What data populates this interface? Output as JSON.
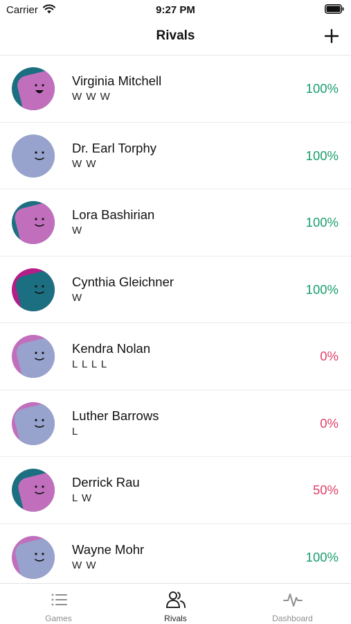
{
  "status_bar": {
    "carrier": "Carrier",
    "time": "9:27 PM"
  },
  "nav": {
    "title": "Rivals",
    "add_icon": "plus-icon"
  },
  "colors": {
    "win": "#1a9e6e",
    "loss": "#e0406a",
    "mixed": "#e0406a",
    "teal": "#1b6f80",
    "pink": "#c16fbd",
    "periwinkle": "#97a3cc",
    "magenta": "#b31e88",
    "tab_active": "#222222",
    "tab_inactive": "#8e8e93"
  },
  "rivals": [
    {
      "name": "Virginia Mitchell",
      "record": "W W W",
      "percent": "100%",
      "status": "win",
      "avatar": {
        "bg": "#1b6f80",
        "fg": "#c16fbd",
        "fg_offset": 0.12,
        "mouth": "open"
      }
    },
    {
      "name": "Dr. Earl Torphy",
      "record": "W W",
      "percent": "100%",
      "status": "win",
      "avatar": {
        "bg": "#97a3cc",
        "fg": "#97a3cc",
        "fg_offset": 0,
        "mouth": "smile"
      }
    },
    {
      "name": "Lora Bashirian",
      "record": "W",
      "percent": "100%",
      "status": "win",
      "avatar": {
        "bg": "#1b6f80",
        "fg": "#c16fbd",
        "fg_offset": 0.06,
        "mouth": "smile"
      }
    },
    {
      "name": "Cynthia Gleichner",
      "record": "W",
      "percent": "100%",
      "status": "win",
      "avatar": {
        "bg": "#b31e88",
        "fg": "#1b6f80",
        "fg_offset": 0.08,
        "mouth": "smile"
      }
    },
    {
      "name": "Kendra Nolan",
      "record": "L L L L",
      "percent": "0%",
      "status": "loss",
      "avatar": {
        "bg": "#c16fbd",
        "fg": "#97a3cc",
        "fg_offset": 0.1,
        "mouth": "smile"
      }
    },
    {
      "name": "Luther Barrows",
      "record": "L",
      "percent": "0%",
      "status": "loss",
      "avatar": {
        "bg": "#c16fbd",
        "fg": "#97a3cc",
        "fg_offset": 0.05,
        "mouth": "smile"
      }
    },
    {
      "name": "Derrick Rau",
      "record": "L W",
      "percent": "50%",
      "status": "mixed",
      "avatar": {
        "bg": "#1b6f80",
        "fg": "#c16fbd",
        "fg_offset": 0.14,
        "mouth": "smile"
      }
    },
    {
      "name": "Wayne Mohr",
      "record": "W W",
      "percent": "100%",
      "status": "win",
      "avatar": {
        "bg": "#c16fbd",
        "fg": "#97a3cc",
        "fg_offset": 0.07,
        "mouth": "smile"
      }
    }
  ],
  "tabs": [
    {
      "label": "Games",
      "icon": "list-icon",
      "active": false
    },
    {
      "label": "Rivals",
      "icon": "people-icon",
      "active": true
    },
    {
      "label": "Dashboard",
      "icon": "pulse-icon",
      "active": false
    }
  ]
}
